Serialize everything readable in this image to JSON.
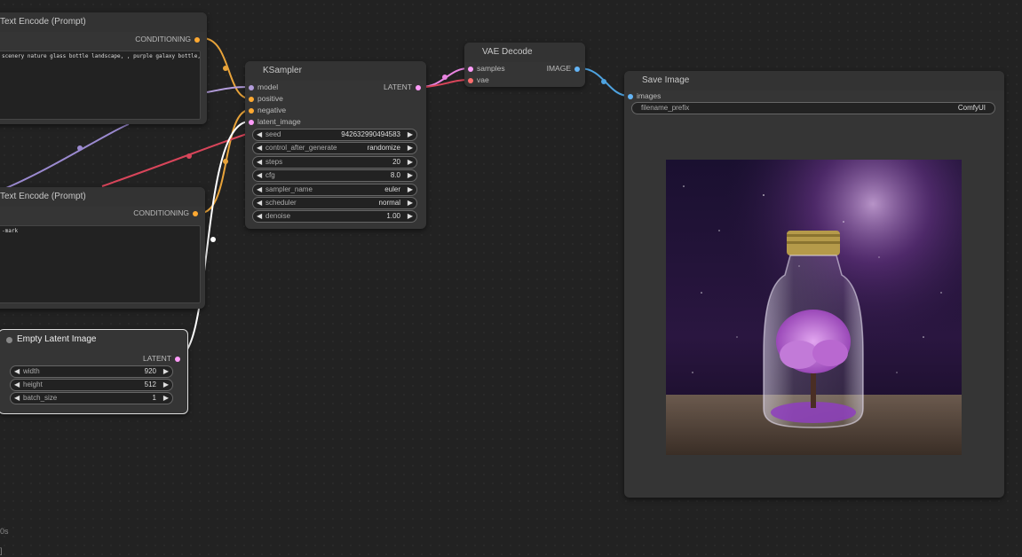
{
  "nodes": {
    "text_encode_pos": {
      "title": "Text Encode (Prompt)",
      "output": "CONDITIONING",
      "text": "scenery nature glass bottle landscape, , purple galaxy bottle,"
    },
    "text_encode_neg": {
      "title": "Text Encode (Prompt)",
      "output": "CONDITIONING",
      "text": "-mark"
    },
    "empty_latent": {
      "title": "Empty Latent Image",
      "output": "LATENT",
      "widgets": [
        {
          "name": "width",
          "value": "920"
        },
        {
          "name": "height",
          "value": "512"
        },
        {
          "name": "batch_size",
          "value": "1"
        }
      ]
    },
    "ksampler": {
      "title": "KSampler",
      "inputs": [
        "model",
        "positive",
        "negative",
        "latent_image"
      ],
      "output": "LATENT",
      "widgets": [
        {
          "name": "seed",
          "value": "942632990494583"
        },
        {
          "name": "control_after_generate",
          "value": "randomize"
        },
        {
          "name": "steps",
          "value": "20"
        },
        {
          "name": "cfg",
          "value": "8.0"
        },
        {
          "name": "sampler_name",
          "value": "euler"
        },
        {
          "name": "scheduler",
          "value": "normal"
        },
        {
          "name": "denoise",
          "value": "1.00"
        }
      ]
    },
    "vae_decode": {
      "title": "VAE Decode",
      "inputs": [
        "samples",
        "vae"
      ],
      "output": "IMAGE"
    },
    "save_image": {
      "title": "Save Image",
      "inputs": [
        "images"
      ],
      "widgets": [
        {
          "name": "filename_prefix",
          "value": "ComfyUI"
        }
      ]
    }
  },
  "status": {
    "line1": "0s",
    "line2": "]"
  },
  "colors": {
    "conditioning": "#ffa931",
    "latent": "#ff9cf9",
    "model": "#b39ddb",
    "vae": "#ff6e6e",
    "image": "#64b5f6",
    "clip": "#ffd500"
  }
}
